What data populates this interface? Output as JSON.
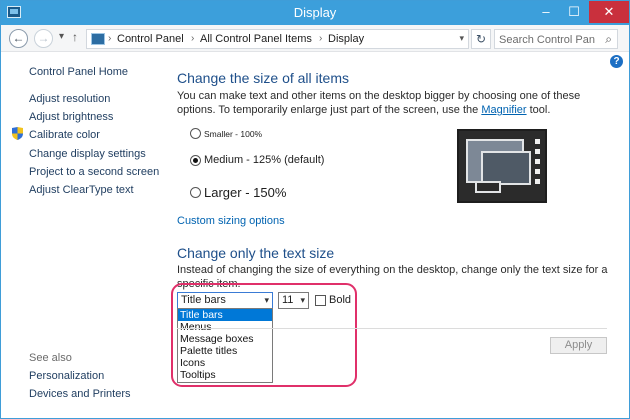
{
  "window": {
    "title": "Display",
    "minimize": "–",
    "maximize": "☐",
    "close": "✕"
  },
  "address": {
    "back": "←",
    "forward": "→",
    "recent": "▾",
    "up": "↑",
    "crumbs": [
      "Control Panel",
      "All Control Panel Items",
      "Display"
    ],
    "separator": "›",
    "dropdown": "▾",
    "refresh": "↻",
    "search_placeholder": "Search Control Panel",
    "search_icon": "⌕"
  },
  "help": "?",
  "sidebar": {
    "home": "Control Panel Home",
    "items": [
      "Adjust resolution",
      "Adjust brightness",
      "Calibrate color",
      "Change display settings",
      "Project to a second screen",
      "Adjust ClearType text"
    ],
    "see_also_label": "See also",
    "see_also": [
      "Personalization",
      "Devices and Printers"
    ]
  },
  "size_section": {
    "heading": "Change the size of all items",
    "description_1": "You can make text and other items on the desktop bigger by choosing one of these options. To temporarily enlarge just part of the screen, use the ",
    "magnifier_link": "Magnifier",
    "description_2": " tool.",
    "options": [
      {
        "label": "Smaller - 100%",
        "selected": false
      },
      {
        "label": "Medium - 125% (default)",
        "selected": true
      },
      {
        "label": "Larger - 150%",
        "selected": false
      }
    ],
    "custom_link": "Custom sizing options"
  },
  "text_section": {
    "heading": "Change only the text size",
    "description": "Instead of changing the size of everything on the desktop, change only the text size for a specific item.",
    "item_select": "Title bars",
    "item_options": [
      "Title bars",
      "Menus",
      "Message boxes",
      "Palette titles",
      "Icons",
      "Tooltips"
    ],
    "size_select": "11",
    "dropdown_arrow": "▾",
    "bold_label": "Bold",
    "bold_checked": false
  },
  "apply_button": "Apply",
  "colors": {
    "titlebar": "#3c9fdb",
    "link": "#0063b1",
    "heading": "#1e4f8a",
    "highlight": "#e0306a",
    "selection": "#0078d7"
  }
}
